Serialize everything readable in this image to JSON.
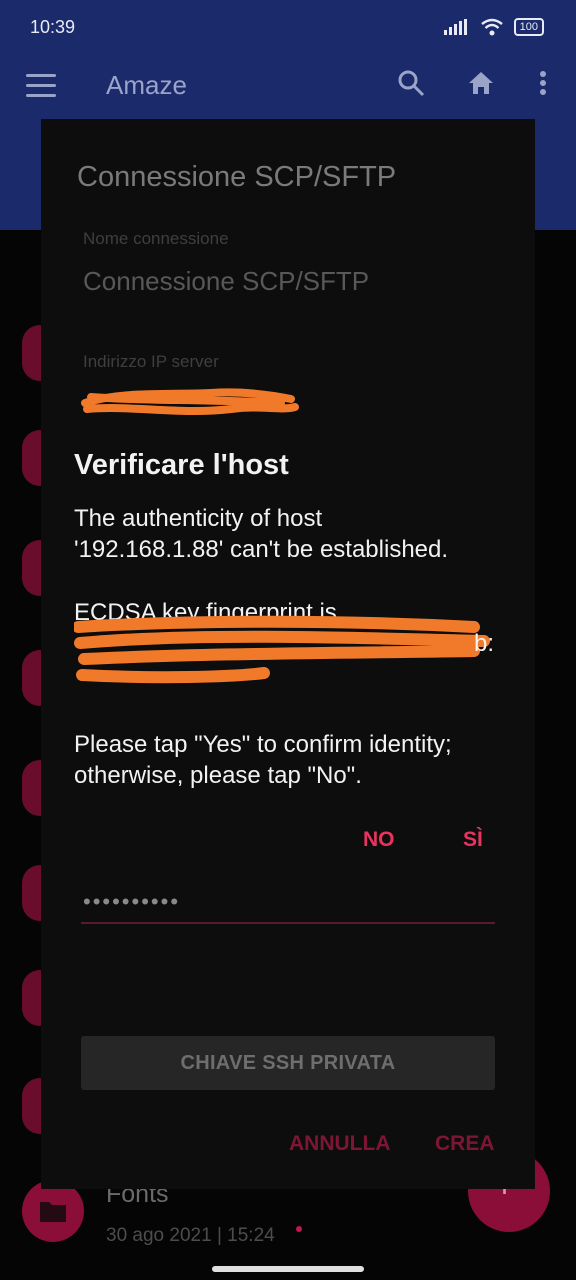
{
  "status_bar": {
    "time": "10:39",
    "battery": "100"
  },
  "app_bar": {
    "title": "Amaze"
  },
  "background_list": {
    "item_name": "Fonts",
    "item_date": "30 ago 2021 | 15:24"
  },
  "connection_dialog": {
    "title": "Connessione SCP/SFTP",
    "name_label": "Nome connessione",
    "name_value": "Connessione SCP/SFTP",
    "ip_label": "Indirizzo IP server",
    "password_value": "••••••••••",
    "ssh_key_button": "CHIAVE SSH PRIVATA",
    "cancel_button": "ANNULLA",
    "create_button": "CREA"
  },
  "verify_dialog": {
    "title": "Verificare l'host",
    "line1": "The authenticity of host",
    "line2": "'192.168.1.88' can't be established.",
    "fingerprint_label": "ECDSA key fingerprint is",
    "confirm_line1": "Please tap \"Yes\" to confirm identity;",
    "confirm_line2": "otherwise, please tap \"No\".",
    "no_button": "NO",
    "yes_button": "SÌ"
  },
  "colors": {
    "accent": "#e8335f",
    "primary": "#1a2a6b",
    "redaction": "#f07a2a"
  },
  "icons": [
    "hamburger-menu-icon",
    "search-icon",
    "home-icon",
    "overflow-menu-icon",
    "folder-icon",
    "plus-icon",
    "signal-icon",
    "wifi-icon",
    "battery-icon"
  ]
}
